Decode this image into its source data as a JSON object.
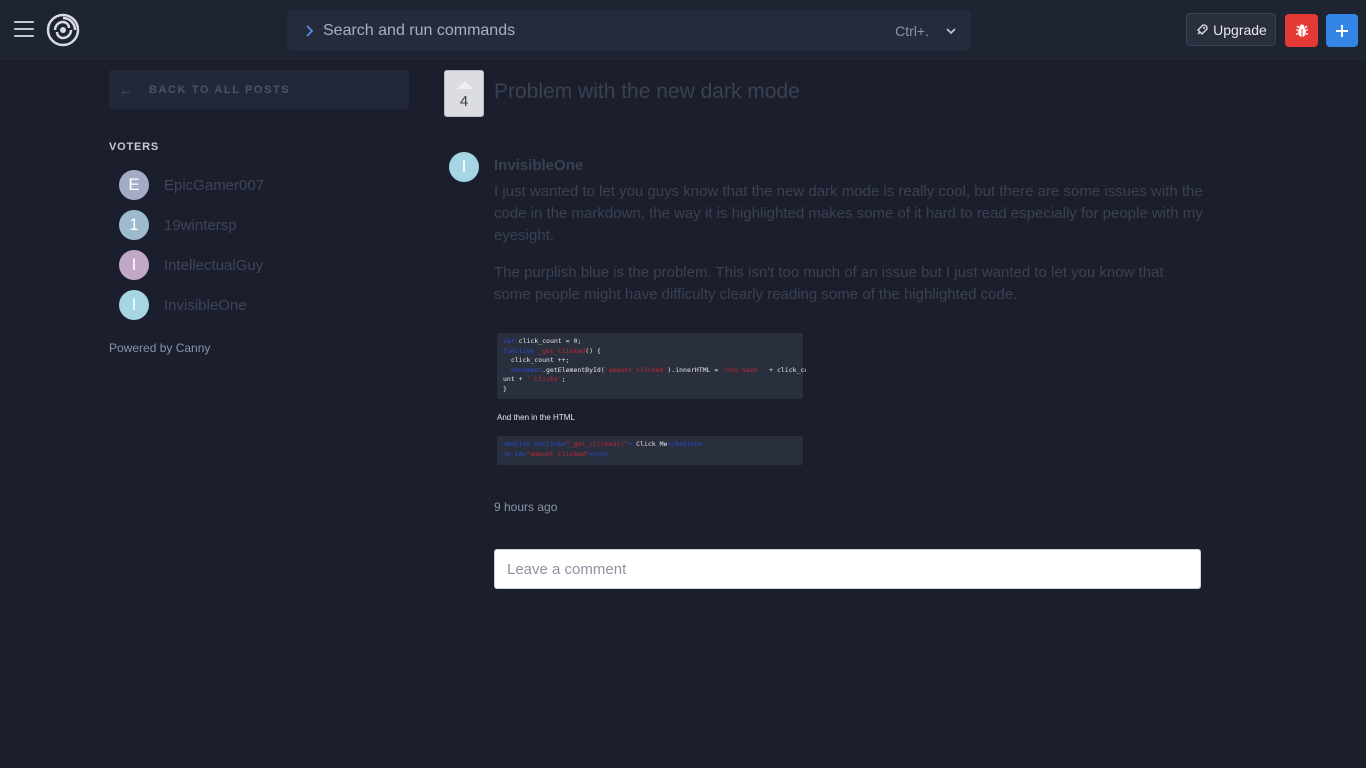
{
  "header": {
    "search": {
      "placeholder": "Search and run commands",
      "shortcut": "Ctrl+."
    },
    "upgrade_label": "Upgrade"
  },
  "sidebar": {
    "back_label": "BACK TO ALL POSTS",
    "back_arrow": "←",
    "voters_heading": "VOTERS",
    "voters": [
      {
        "initial": "E",
        "name": "EpicGamer007",
        "color": "#a3acc4"
      },
      {
        "initial": "1",
        "name": "19wintersp",
        "color": "#9dbbcf"
      },
      {
        "initial": "I",
        "name": "IntellectualGuy",
        "color": "#c2a8c7"
      },
      {
        "initial": "I",
        "name": "InvisibleOne",
        "color": "#a6d5e3"
      }
    ],
    "powered_by": "Powered by Canny"
  },
  "post": {
    "vote_count": "4",
    "title": "Problem with the new dark mode",
    "author": {
      "initial": "I",
      "name": "InvisibleOne"
    },
    "paragraphs": [
      "I just wanted to let you guys know that the new dark mode is really cool, but there are some issues with the code in the markdown, the way it is highlighted makes some of it hard to read especially for people with my eyesight.",
      "The purplish blue is the problem. This isn't too much of an issue but I just wanted to let you know that some people might have difficulty clearly reading some of the highlighted code."
    ],
    "image": {
      "caption": "And then in the HTML"
    },
    "timestamp": "9 hours ago"
  },
  "comment": {
    "placeholder": "Leave a comment"
  },
  "colors": {
    "accent_blue": "#3385e6",
    "bug_red": "#e53935",
    "background": "#1b1f2d"
  }
}
